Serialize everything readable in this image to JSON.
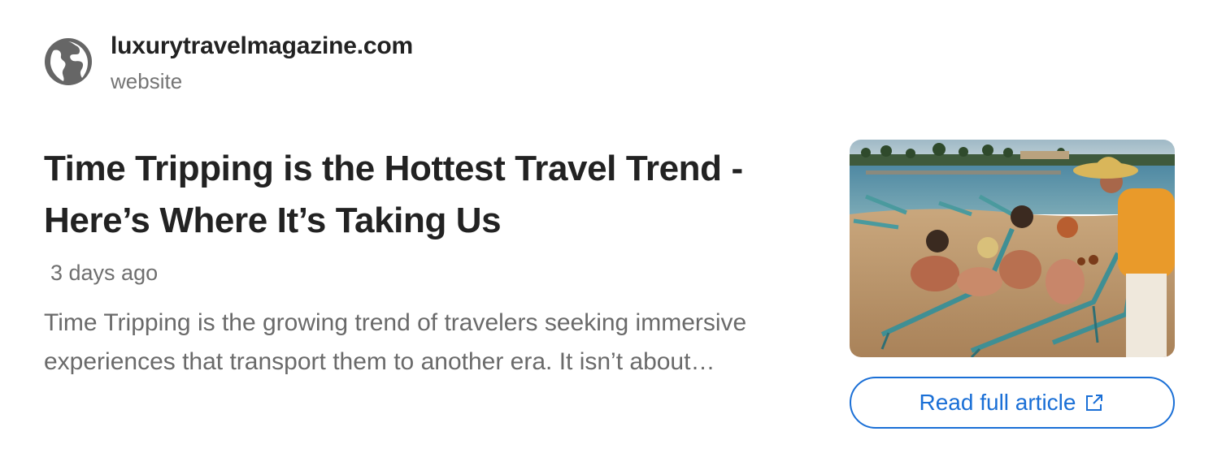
{
  "source": {
    "domain": "luxurytravelmagazine.com",
    "kind": "website",
    "icon": "globe-icon"
  },
  "article": {
    "headline_line1": "Time Tripping is the Hottest Travel Trend -",
    "headline_line2": "Here’s Where It’s Taking Us",
    "timestamp": "3 days ago",
    "summary_line1": "Time Tripping is the growing trend of travelers seeking immersive",
    "summary_line2": "experiences that transport them to another era. It isn’t about…"
  },
  "thumbnail": {
    "subject": "vintage beach photo: group on lounge chairs, man in straw hat and orange shirt serving drinks"
  },
  "actions": {
    "read_full_article": "Read full article",
    "read_icon": "external-link-icon"
  },
  "colors": {
    "accent": "#1a6fd6",
    "title": "#222222",
    "muted": "#6a6a6a",
    "globe": "#666666"
  }
}
